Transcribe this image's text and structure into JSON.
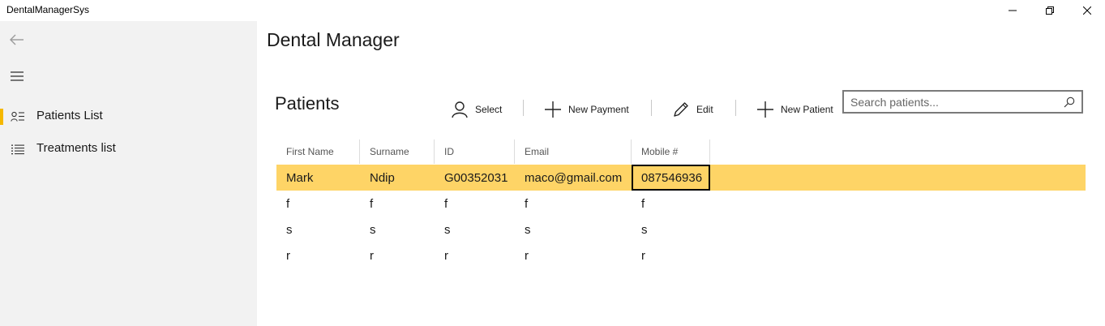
{
  "window": {
    "title": "DentalManagerSys",
    "controls": [
      "minimize",
      "maximize",
      "close"
    ]
  },
  "sidebar": {
    "back_icon": "back-arrow-icon",
    "menu_icon": "hamburger-icon",
    "items": [
      {
        "label": "Patients List",
        "icon": "contact-list-icon",
        "selected": true
      },
      {
        "label": "Treatments list",
        "icon": "bulleted-list-icon",
        "selected": false
      }
    ]
  },
  "header": {
    "title": "Dental Manager"
  },
  "main": {
    "section_title": "Patients",
    "commands": {
      "select": "Select",
      "new_payment": "New Payment",
      "edit": "Edit",
      "new_patient": "New Patient"
    },
    "search": {
      "placeholder": "Search patients...",
      "value": ""
    },
    "table": {
      "columns": [
        "First Name",
        "Surname",
        "ID",
        "Email",
        "Mobile #"
      ],
      "rows": [
        [
          "Mark",
          "Ndip",
          "G00352031",
          "maco@gmail.com",
          "087546936"
        ],
        [
          "f",
          "f",
          "f",
          "f",
          "f"
        ],
        [
          "s",
          "s",
          "s",
          "s",
          "s"
        ],
        [
          "r",
          "r",
          "r",
          "r",
          "r"
        ]
      ],
      "selected_row": 0
    }
  },
  "colors": {
    "accent": "#f5b800",
    "selection": "#fed466",
    "sidebar_bg": "#f2f2f2"
  }
}
